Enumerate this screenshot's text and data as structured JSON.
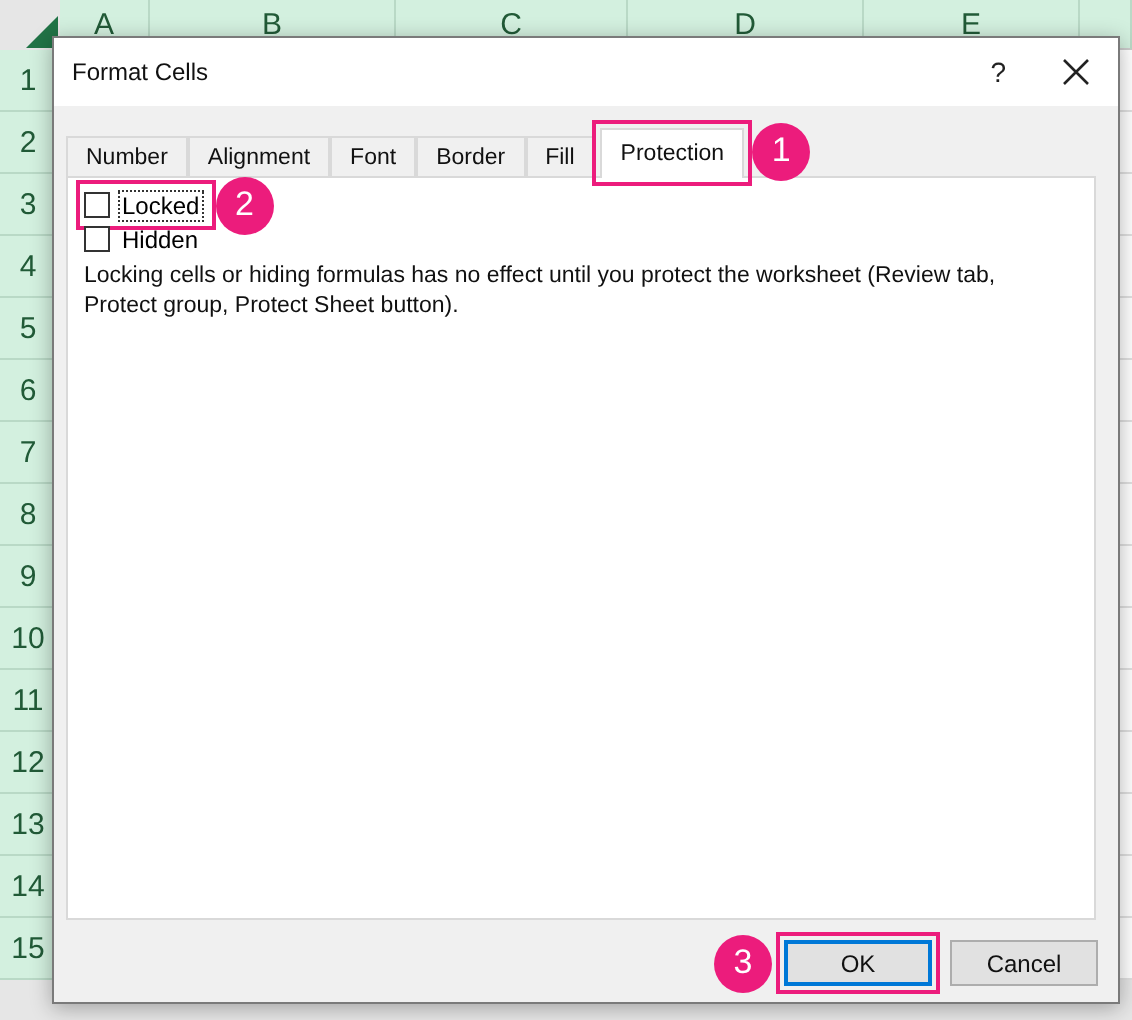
{
  "sheet": {
    "columns": [
      "A",
      "B",
      "C",
      "D",
      "E"
    ],
    "rows": [
      "1",
      "2",
      "3",
      "4",
      "5",
      "6",
      "7",
      "8",
      "9",
      "10",
      "11",
      "12",
      "13",
      "14",
      "15"
    ]
  },
  "dialog": {
    "title": "Format Cells",
    "help": "?",
    "tabs": [
      {
        "label": "Number",
        "selected": false
      },
      {
        "label": "Alignment",
        "selected": false
      },
      {
        "label": "Font",
        "selected": false
      },
      {
        "label": "Border",
        "selected": false
      },
      {
        "label": "Fill",
        "selected": false
      },
      {
        "label": "Protection",
        "selected": true,
        "callout": "1"
      }
    ],
    "options": [
      {
        "label": "Locked",
        "checked": false,
        "focused": true,
        "callout": "2"
      },
      {
        "label": "Hidden",
        "checked": false,
        "focused": false
      }
    ],
    "note": "Locking cells or hiding formulas has no effect until you protect the worksheet (Review tab, Protect group, Protect Sheet button).",
    "buttons": [
      {
        "label": "OK",
        "default": true,
        "callout": "3"
      },
      {
        "label": "Cancel",
        "default": false
      }
    ]
  }
}
